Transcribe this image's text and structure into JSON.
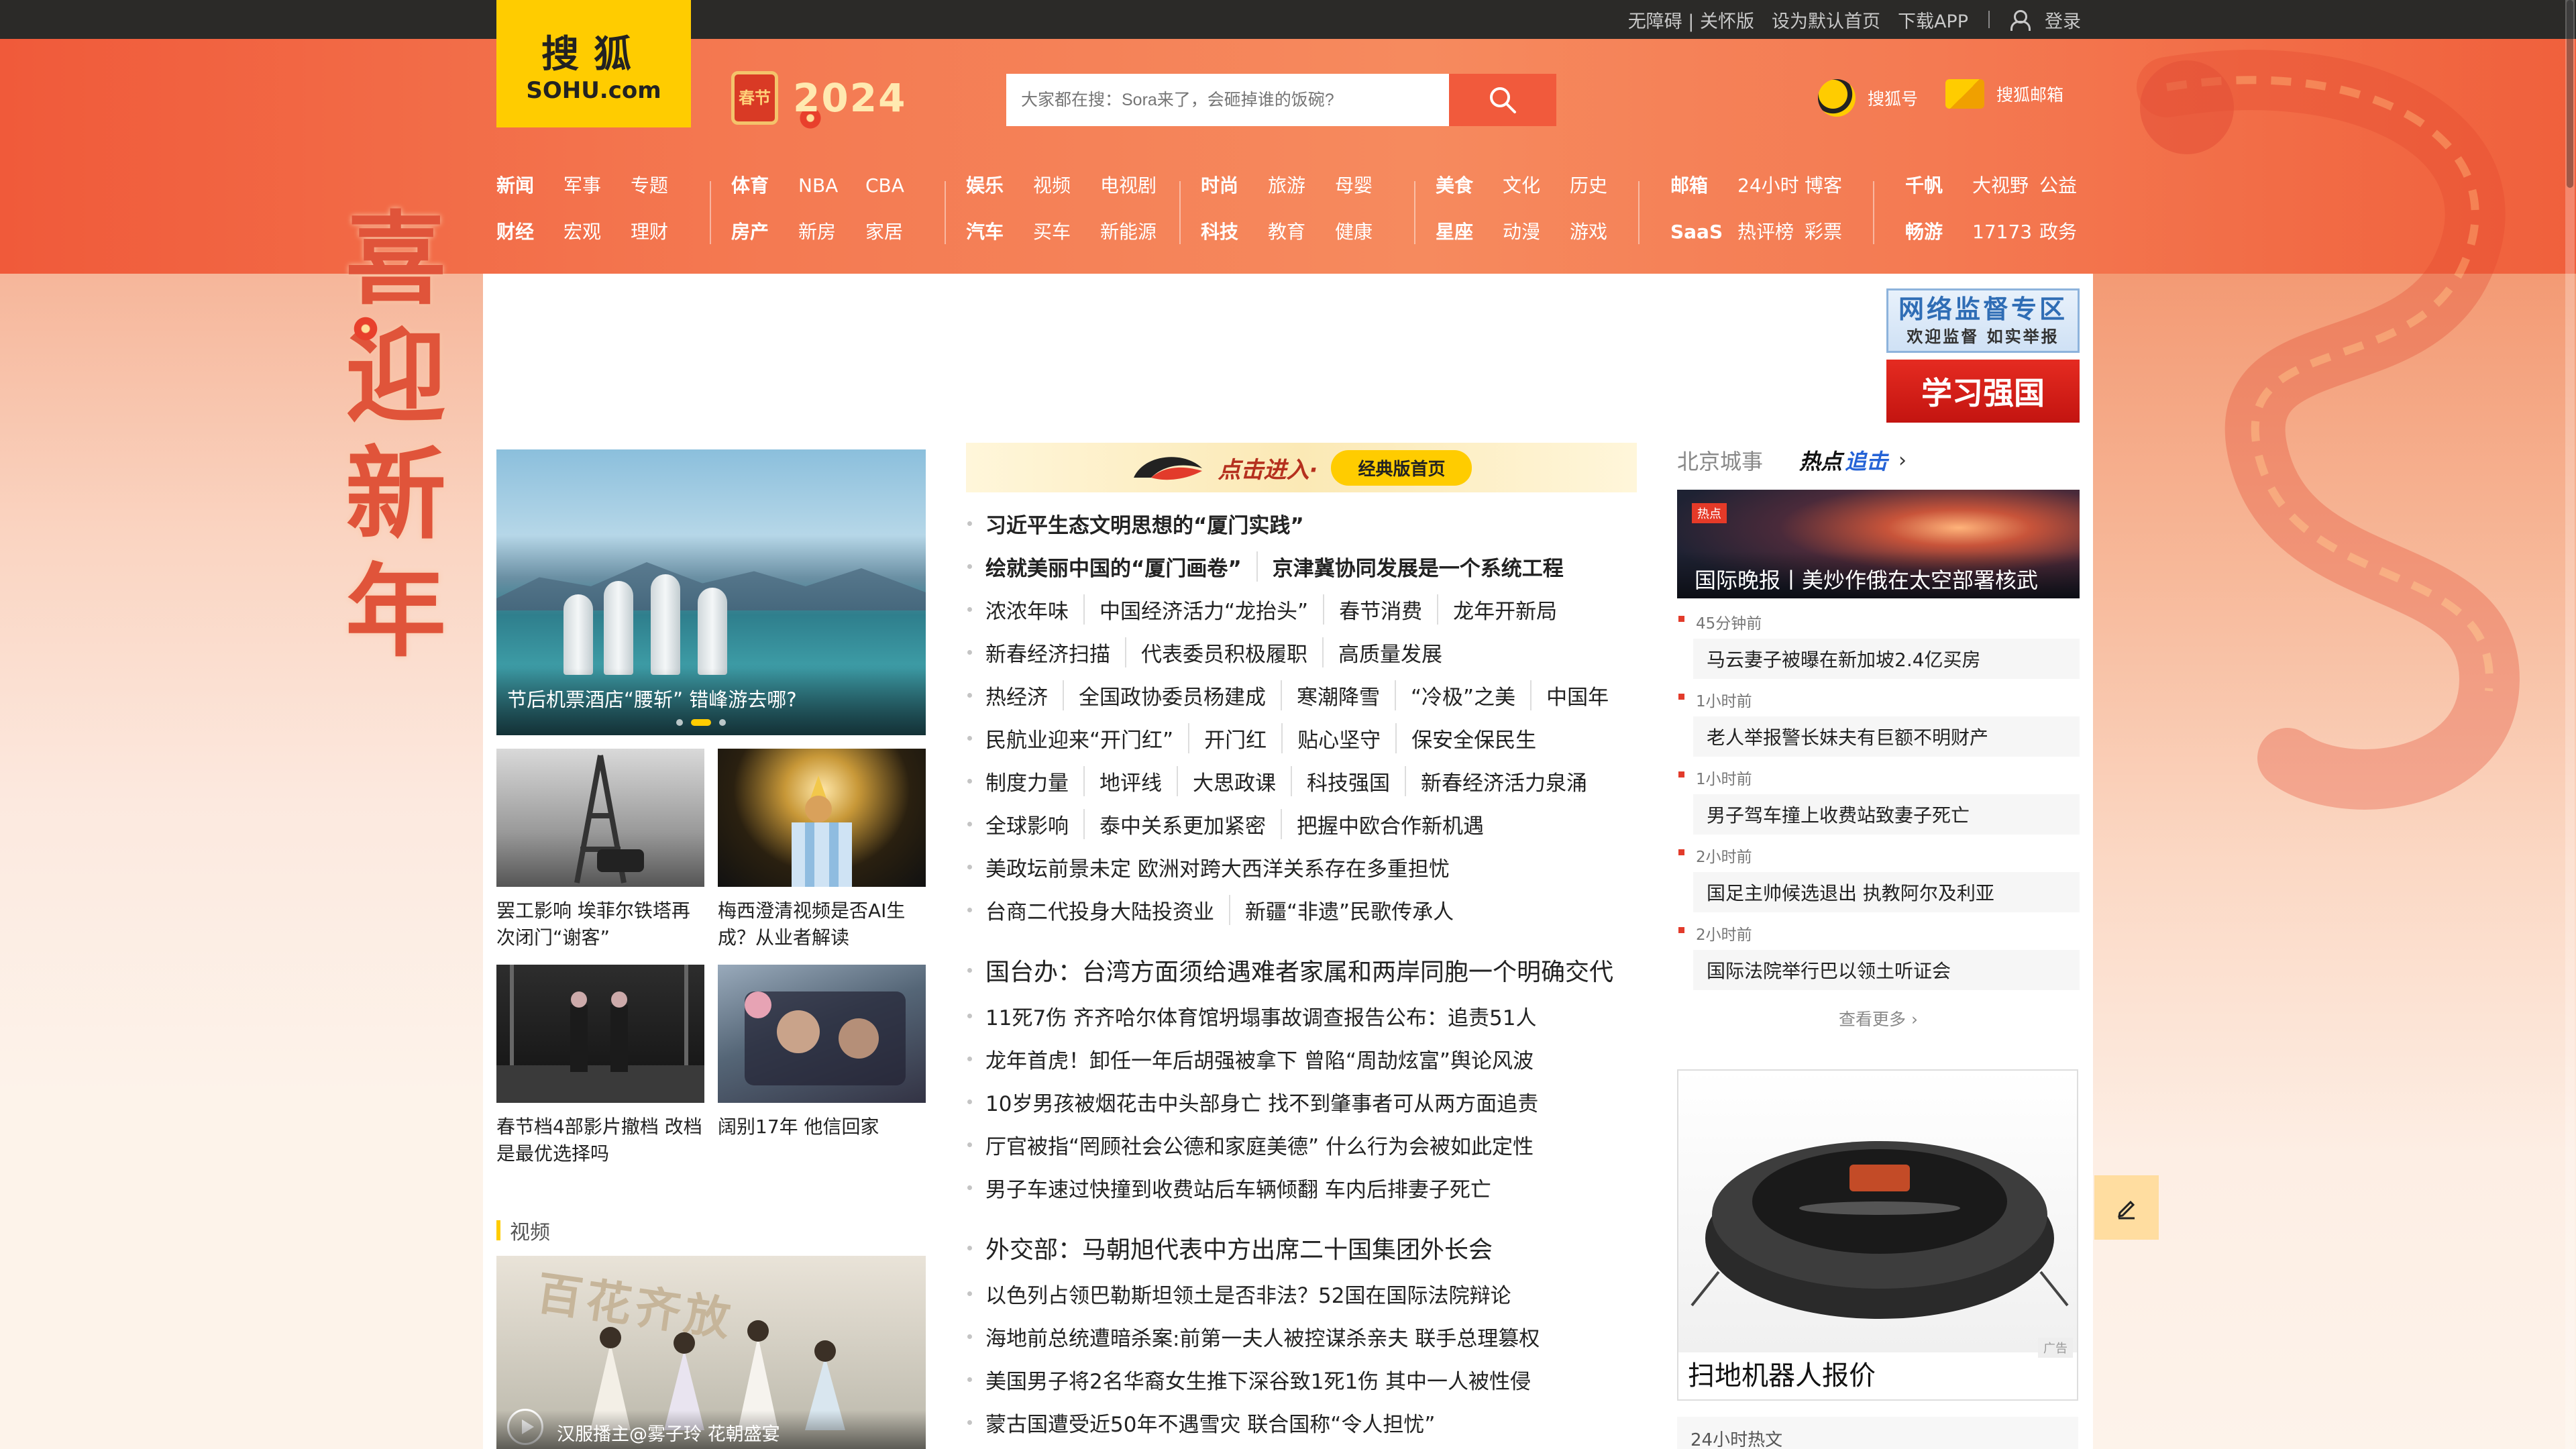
{
  "topbar": {
    "links": [
      "无障碍 | 关怀版",
      "设为默认首页",
      "下载APP"
    ],
    "login": "登录"
  },
  "logo": {
    "cn": "搜狐",
    "en": "SOHU.com"
  },
  "festival": {
    "seal": "春节",
    "year": "2024",
    "slogan": [
      "喜",
      "迎",
      "新",
      "年"
    ]
  },
  "search": {
    "placeholder": "大家都在搜：Sora来了，会砸掉谁的饭碗?"
  },
  "header_links": {
    "sohuhao": "搜狐号",
    "mail": "搜狐邮箱"
  },
  "nav": [
    {
      "row1": [
        "新闻",
        "军事",
        "专题"
      ],
      "row2": [
        "财经",
        "宏观",
        "理财"
      ]
    },
    {
      "row1": [
        "体育",
        "NBA",
        "CBA"
      ],
      "row2": [
        "房产",
        "新房",
        "家居"
      ]
    },
    {
      "row1": [
        "娱乐",
        "视频",
        "电视剧"
      ],
      "row2": [
        "汽车",
        "买车",
        "新能源"
      ]
    },
    {
      "row1": [
        "时尚",
        "旅游",
        "母婴"
      ],
      "row2": [
        "科技",
        "教育",
        "健康"
      ]
    },
    {
      "row1": [
        "美食",
        "文化",
        "历史"
      ],
      "row2": [
        "星座",
        "动漫",
        "游戏"
      ]
    },
    {
      "row1": [
        "邮箱",
        "24小时",
        "博客"
      ],
      "row2": [
        "SaaS",
        "热评榜",
        "彩票"
      ]
    },
    {
      "row1": [
        "千帆",
        "大视野",
        "公益"
      ],
      "row2": [
        "畅游",
        "17173",
        "政务"
      ]
    }
  ],
  "side_ads": {
    "supervision_l1": "网络监督专区",
    "supervision_l2": "欢迎监督 如实举报",
    "xuexi": "学习强国"
  },
  "hero": {
    "caption": "节后机票酒店“腰斩” 错峰游去哪?"
  },
  "thumbs": [
    {
      "title": "罢工影响 埃菲尔铁塔再次闭门“谢客”"
    },
    {
      "title": "梅西澄清视频是否AI生成？从业者解读"
    },
    {
      "title": "春节档4部影片撤档 改档是最优选择吗"
    },
    {
      "title": "阔别17年 他信回家"
    }
  ],
  "video_section": {
    "title": "视频",
    "art": "百花齐放",
    "caption": "汉服播主@雾子玲 花朝盛宴"
  },
  "classic": {
    "enter": "点击进入·",
    "pill": "经典版首页"
  },
  "news_block1": [
    {
      "bold": true,
      "items": [
        "习近平生态文明思想的“厦门实践”"
      ]
    },
    {
      "bold": true,
      "items": [
        "绘就美丽中国的“厦门画卷”",
        "京津冀协同发展是一个系统工程"
      ]
    },
    {
      "bold": false,
      "items": [
        "浓浓年味",
        "中国经济活力“龙抬头”",
        "春节消费",
        "龙年开新局"
      ]
    },
    {
      "bold": false,
      "items": [
        "新春经济扫描",
        "代表委员积极履职",
        "高质量发展"
      ]
    },
    {
      "bold": false,
      "items": [
        "热经济",
        "全国政协委员杨建成",
        "寒潮降雪",
        "“冷极”之美",
        "中国年"
      ]
    },
    {
      "bold": false,
      "items": [
        "民航业迎来“开门红”",
        "开门红",
        "贴心坚守",
        "保安全保民生"
      ]
    },
    {
      "bold": false,
      "items": [
        "制度力量",
        "地评线",
        "大思政课",
        "科技强国",
        "新春经济活力泉涌"
      ]
    },
    {
      "bold": false,
      "items": [
        "全球影响",
        "泰中关系更加紧密",
        "把握中欧合作新机遇"
      ]
    },
    {
      "bold": false,
      "items": [
        "美政坛前景未定 欧洲对跨大西洋关系存在多重担忧"
      ]
    },
    {
      "bold": false,
      "items": [
        "台商二代投身大陆投资业",
        "新疆“非遗”民歌传承人"
      ]
    }
  ],
  "news_block2": [
    {
      "big": true,
      "items": [
        "国台办：台湾方面须给遇难者家属和两岸同胞一个明确交代"
      ]
    },
    {
      "big": false,
      "items": [
        "11死7伤 齐齐哈尔体育馆坍塌事故调查报告公布：追责51人"
      ]
    },
    {
      "big": false,
      "items": [
        "龙年首虎！卸任一年后胡强被拿下 曾陷“周劼炫富”舆论风波"
      ]
    },
    {
      "big": false,
      "items": [
        "10岁男孩被烟花击中头部身亡 找不到肇事者可从两方面追责"
      ]
    },
    {
      "big": false,
      "items": [
        "厅官被指“罔顾社会公德和家庭美德” 什么行为会被如此定性"
      ]
    },
    {
      "big": false,
      "items": [
        "男子车速过快撞到收费站后车辆倾翻 车内后排妻子死亡"
      ]
    }
  ],
  "news_block3": [
    {
      "big": true,
      "items": [
        "外交部：马朝旭代表中方出席二十国集团外长会"
      ]
    },
    {
      "big": false,
      "items": [
        "以色列占领巴勒斯坦领土是否非法？52国在国际法院辩论"
      ]
    },
    {
      "big": false,
      "items": [
        "海地前总统遭暗杀案:前第一夫人被控谋杀亲夫 联手总理篡权"
      ]
    },
    {
      "big": false,
      "items": [
        "美国男子将2名华裔女生推下深谷致1死1伤 其中一人被性侵"
      ]
    },
    {
      "big": false,
      "items": [
        "蒙古国遭受近50年不遇雪灾 联合国称“令人担忧”"
      ]
    }
  ],
  "right": {
    "city": "北京城事",
    "hot": "热点",
    "chase": "追击",
    "feature": "国际晚报丨美炒作俄在太空部署核武",
    "feature_tag": "热点",
    "list": [
      {
        "time": "45分钟前",
        "title": "马云妻子被曝在新加坡2.4亿买房"
      },
      {
        "time": "1小时前",
        "title": "老人举报警长妹夫有巨额不明财产"
      },
      {
        "time": "1小时前",
        "title": "男子驾车撞上收费站致妻子死亡"
      },
      {
        "time": "2小时前",
        "title": "国足主帅候选退出 执教阿尔及利亚"
      },
      {
        "time": "2小时前",
        "title": "国际法院举行巴以领土听证会"
      }
    ],
    "more": "查看更多",
    "ad_title": "扫地机器人报价",
    "ad_tag": "广告",
    "bottom": "24小时热文"
  }
}
